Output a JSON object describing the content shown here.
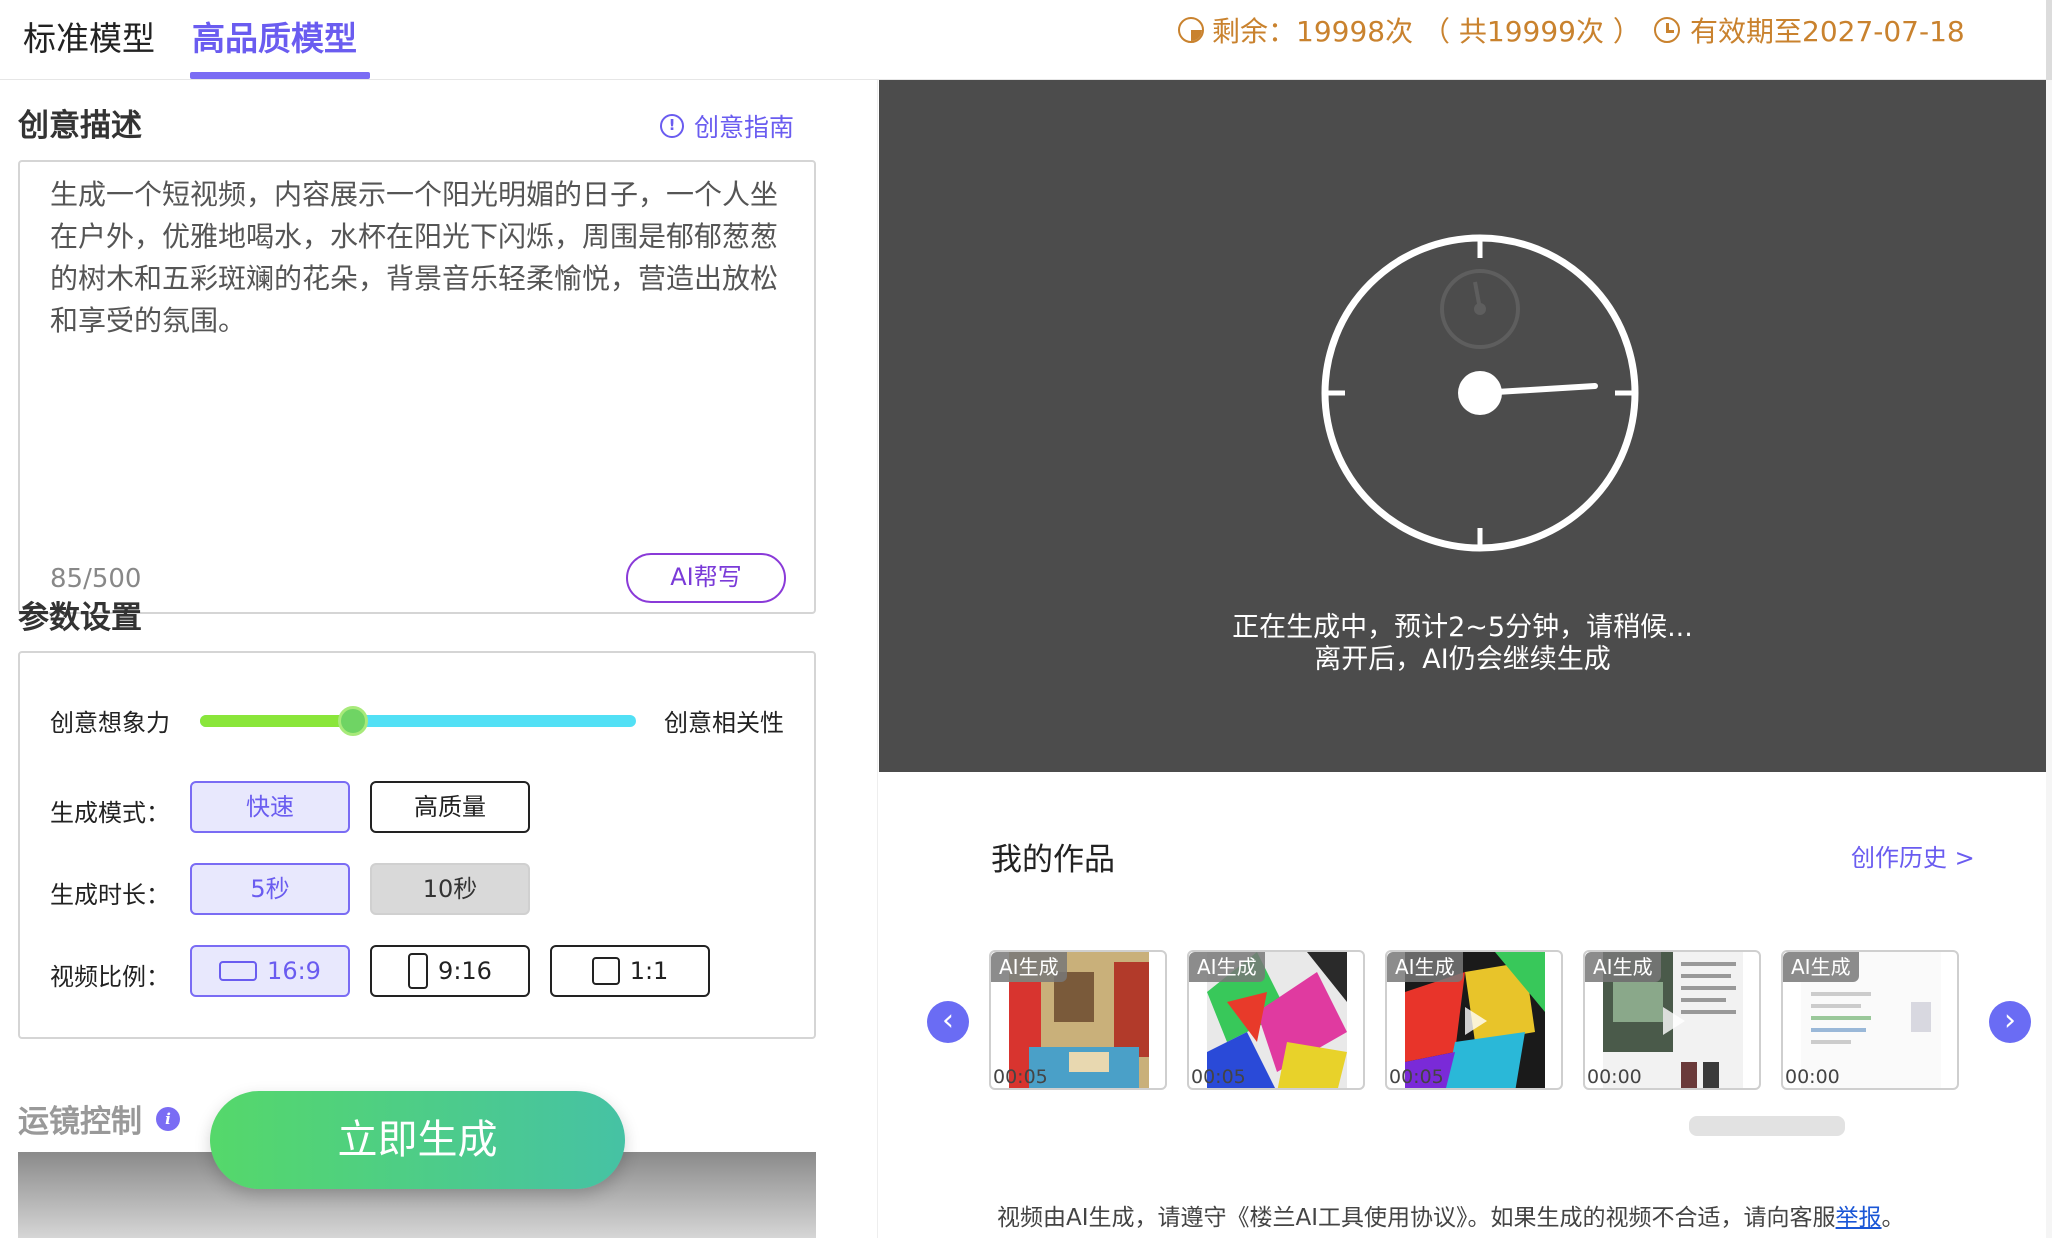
{
  "tabs": [
    {
      "label": "标准模型",
      "active": false
    },
    {
      "label": "高品质模型",
      "active": true
    }
  ],
  "quota": {
    "text": "剩余：19998次 （ 共19999次 ）",
    "icon": "pie-icon"
  },
  "expiry": {
    "text": "有效期至2027-07-18",
    "icon": "clock-icon"
  },
  "creative": {
    "title": "创意描述",
    "guide_label": "创意指南",
    "description": "生成一个短视频，内容展示一个阳光明媚的日子，一个人坐在户外，优雅地喝水，水杯在阳光下闪烁，周围是郁郁葱葱的树木和五彩斑斓的花朵，背景音乐轻柔愉悦，营造出放松和享受的氛围。",
    "counter": "85/500",
    "ai_write_label": "AI帮写"
  },
  "params": {
    "title": "参数设置",
    "slider": {
      "left_label": "创意想象力",
      "right_label": "创意相关性",
      "value": 0.35
    },
    "mode": {
      "label": "生成模式：",
      "options": [
        "快速",
        "高质量"
      ],
      "selected": 0
    },
    "duration": {
      "label": "生成时长：",
      "options": [
        "5秒",
        "10秒"
      ],
      "selected": 0
    },
    "ratio": {
      "label": "视频比例：",
      "options": [
        "16:9",
        "9:16",
        "1:1"
      ],
      "selected": 0
    }
  },
  "camera": {
    "title": "运镜控制",
    "info_icon": "i"
  },
  "generate_label": "立即生成",
  "preview": {
    "status_line1": "正在生成中，预计2~5分钟，请稍候...",
    "status_line2": "离开后，AI仍会继续生成"
  },
  "works": {
    "title": "我的作品",
    "history_label": "创作历史 >",
    "items": [
      {
        "badge": "AI生成",
        "time": "00:05"
      },
      {
        "badge": "AI生成",
        "time": "00:05"
      },
      {
        "badge": "AI生成",
        "time": "00:05"
      },
      {
        "badge": "AI生成",
        "time": "00:00"
      },
      {
        "badge": "AI生成",
        "time": "00:00"
      }
    ],
    "prev_label": "‹",
    "next_label": "›"
  },
  "notice": {
    "text": "视频由AI生成，请遵守《楼兰AI工具使用协议》。如果生成的视频不合适，请向客服",
    "link_label": "举报",
    "end": "。"
  },
  "colors": {
    "accent": "#6a5cf0",
    "gold": "#c9822e",
    "preview_bg": "#4c4c4c",
    "generate_from": "#55d86a",
    "generate_to": "#46c2a4"
  }
}
